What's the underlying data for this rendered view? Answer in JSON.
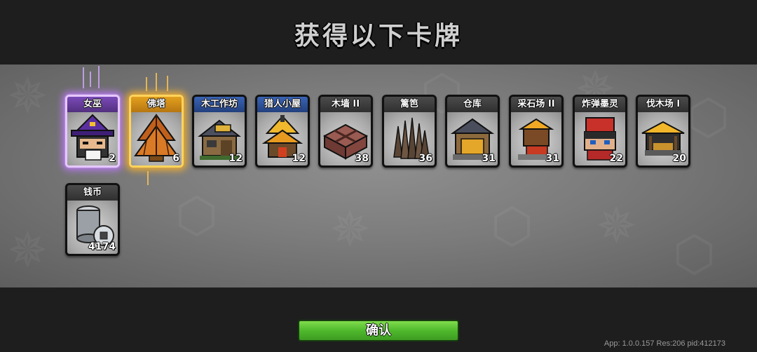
{
  "title": "获得以下卡牌",
  "cards": [
    {
      "name": "女巫",
      "count": "2",
      "rarity": "purple",
      "icon": "witch-icon"
    },
    {
      "name": "佛塔",
      "count": "6",
      "rarity": "gold",
      "icon": "pagoda-icon"
    },
    {
      "name": "木工作坊",
      "count": "12",
      "rarity": "blue",
      "icon": "carpentry-workshop-icon"
    },
    {
      "name": "猎人小屋",
      "count": "12",
      "rarity": "blue",
      "icon": "hunter-hut-icon"
    },
    {
      "name": "木墙 II",
      "count": "38",
      "rarity": "gray",
      "icon": "wooden-wall-icon"
    },
    {
      "name": "篱笆",
      "count": "36",
      "rarity": "gray",
      "icon": "fence-icon"
    },
    {
      "name": "仓库",
      "count": "31",
      "rarity": "gray",
      "icon": "warehouse-icon"
    },
    {
      "name": "采石场 II",
      "count": "31",
      "rarity": "gray",
      "icon": "quarry-icon"
    },
    {
      "name": "炸弹墨灵",
      "count": "22",
      "rarity": "gray",
      "icon": "bomb-ink-spirit-icon"
    },
    {
      "name": "伐木场 I",
      "count": "20",
      "rarity": "gray",
      "icon": "lumber-mill-icon"
    },
    {
      "name": "钱币",
      "count": "4174",
      "rarity": "gray",
      "icon": "coin-icon"
    }
  ],
  "confirm_label": "确认",
  "version_text": "App: 1.0.0.157 Res:206 pid:412173"
}
